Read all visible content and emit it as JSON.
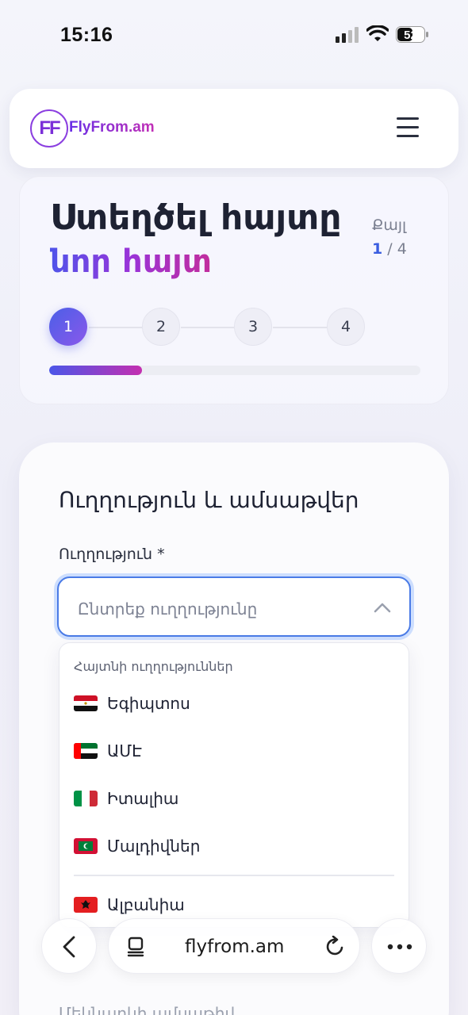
{
  "status_bar": {
    "time": "15:16",
    "battery": "52"
  },
  "header": {
    "logo_badge": "FF",
    "logo_text": "FlyFrom.am",
    "menu_icon": "hamburger-icon"
  },
  "progress": {
    "title_line1": "Ստեղծել հայտը",
    "title_line2": "նոր հայտ",
    "step_label": "Քայլ",
    "current_step": "1",
    "total_steps": "/ 4",
    "steps": [
      "1",
      "2",
      "3",
      "4"
    ],
    "progress_fraction": 0.25
  },
  "form": {
    "section_title": "Ուղղություն և ամսաթվեր",
    "direction_label": "Ուղղություն *",
    "direction_placeholder": "Ընտրեք ուղղությունը",
    "dropdown": {
      "header": "Հայտնի ուղղություններ",
      "items": [
        {
          "label": "Եգիպտոս",
          "flag": "egypt-flag"
        },
        {
          "label": "ԱՄԷ",
          "flag": "uae-flag"
        },
        {
          "label": "Իտալիա",
          "flag": "italy-flag"
        },
        {
          "label": "Մալդիվներ",
          "flag": "maldives-flag"
        },
        {
          "label": "Ալբանիա",
          "flag": "albania-flag"
        }
      ]
    },
    "footer_hint": "Մեկնարկի ամսաթիվ"
  },
  "browser_bar": {
    "url": "flyfrom.am"
  },
  "colors": {
    "accent_blue": "#4a7be6",
    "gradient_start": "#4b56e8",
    "gradient_end": "#c42fb0"
  }
}
